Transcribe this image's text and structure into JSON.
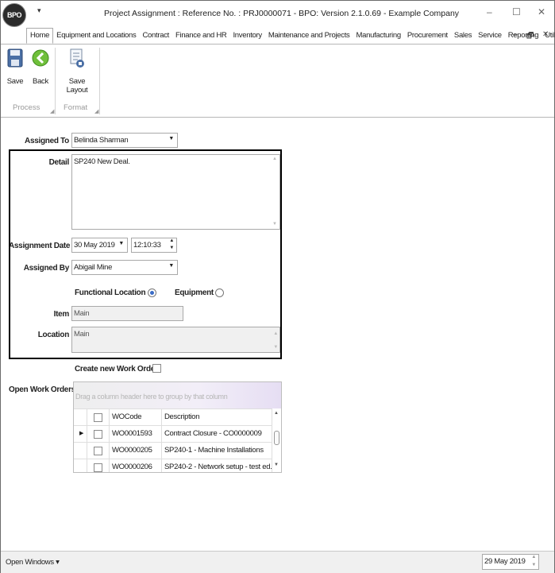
{
  "window": {
    "logo_text": "BPO",
    "quick_access": "▾",
    "title": "Project Assignment : Reference No. : PRJ0000071 - BPO: Version 2.1.0.69 - Example Company",
    "minimize": "–",
    "maximize": "☐",
    "close": "✕"
  },
  "ribbon": {
    "tabs": [
      "Home",
      "Equipment and Locations",
      "Contract",
      "Finance and HR",
      "Inventory",
      "Maintenance and Projects",
      "Manufacturing",
      "Procurement",
      "Sales",
      "Service",
      "Reporting",
      "Utilities"
    ],
    "tab_controls": [
      "–",
      "🗗",
      "✕"
    ],
    "buttons": {
      "save": "Save",
      "back": "Back",
      "save_layout": "Save Layout"
    },
    "groups": {
      "process": "Process",
      "format": "Format"
    }
  },
  "form": {
    "assigned_to_label": "Assigned To",
    "assigned_to_value": "Belinda Sharman",
    "detail_label": "Detail",
    "detail_value": "SP240 New Deal.",
    "assignment_date_label": "Assignment Date",
    "assignment_date_value": "30 May 2019",
    "assignment_time_value": "12:10:33",
    "assigned_by_label": "Assigned By",
    "assigned_by_value": "Abigail Mine",
    "functional_location_label": "Functional Location",
    "equipment_label": "Equipment",
    "item_label": "Item",
    "item_value": "Main",
    "location_label": "Location",
    "location_value": "Main",
    "create_wo_label": "Create new Work Order",
    "open_wo_label": "Open Work Orders"
  },
  "grid": {
    "group_hint": "Drag a column header here to group by that column",
    "columns": [
      "WOCode",
      "Description"
    ],
    "rows": [
      {
        "code": "WO0001593",
        "desc": "Contract Closure - CO0000009"
      },
      {
        "code": "WO0000205",
        "desc": "SP240-1 - Machine Installations"
      },
      {
        "code": "WO0000206",
        "desc": "SP240-2 - Network setup - test ed..."
      }
    ]
  },
  "status": {
    "open_windows": "Open Windows ▾",
    "date": "29 May 2019"
  }
}
